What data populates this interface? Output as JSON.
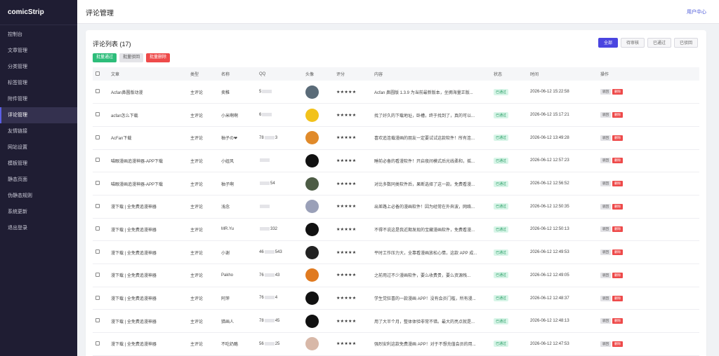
{
  "app": {
    "brand": "comicStrip"
  },
  "sidebar": {
    "items": [
      {
        "label": "控制台"
      },
      {
        "label": "文章管理"
      },
      {
        "label": "分类管理"
      },
      {
        "label": "标签管理"
      },
      {
        "label": "附件管理"
      },
      {
        "label": "评论管理",
        "active": true
      },
      {
        "label": "友情链接"
      },
      {
        "label": "网站设置"
      },
      {
        "label": "模板管理"
      },
      {
        "label": "静态页面"
      },
      {
        "label": "伪静态规则"
      },
      {
        "label": "系统更新"
      },
      {
        "label": "退出登录"
      }
    ]
  },
  "header": {
    "title": "评论管理",
    "user_center": "用户中心"
  },
  "card": {
    "title": "评论列表 (17)",
    "filters": [
      "全部",
      "待审核",
      "已通过",
      "已驳回"
    ],
    "bulk": {
      "approve": "批量通过",
      "reject": "批量驳回",
      "delete": "批量删除"
    }
  },
  "table": {
    "headers": [
      "文章",
      "类型",
      "名称",
      "QQ",
      "头像",
      "评分",
      "内容",
      "状态",
      "时间",
      "操作"
    ],
    "op_reject": "驳回",
    "op_delete": "删除",
    "rows": [
      {
        "article": "Acfan鼻圆版动漫",
        "type": "主评论",
        "name": "卖稚",
        "qq_pre": "5",
        "qq_post": "",
        "rating": "★★★★★",
        "content": "Acfan 鼻圆版 1.3.9 为当前最新版本，坐拥海量正版...",
        "status": "已通过",
        "time": "2026-06-12 15:22:58",
        "avatar": "#5a6b78"
      },
      {
        "article": "acfan怎么下载",
        "type": "主评论",
        "name": "小米啊啊",
        "qq_pre": "6",
        "qq_post": "",
        "rating": "★★★★★",
        "content": "找了好久的下载地址，卧槽，终于找到了，真的可以...",
        "status": "已通过",
        "time": "2026-06-12 15:17:21",
        "avatar": "#f2c21b"
      },
      {
        "article": "AcFan下载",
        "type": "主评论",
        "name": "柚子の❤",
        "qq_pre": "78",
        "qq_post": "3",
        "rating": "★★★★★",
        "content": "喜欢追连载漫画的朋友一定要试试这款软件！所有连...",
        "status": "已通过",
        "time": "2026-06-12 13:49:28",
        "avatar": "#e08a2a"
      },
      {
        "article": "喵眼漫画追漫神器-APP下载",
        "type": "主评论",
        "name": "小妞风",
        "qq_pre": "",
        "qq_post": "",
        "rating": "★★★★★",
        "content": "睡前必备的看漫软件！开启夜间模式后光线柔和，摇...",
        "status": "已通过",
        "time": "2026-06-12 12:57:23",
        "avatar": "#111111"
      },
      {
        "article": "喵眼漫画追漫神器-APP下载",
        "type": "主评论",
        "name": "柚子啊",
        "qq_pre": "",
        "qq_post": "54",
        "rating": "★★★★★",
        "content": "对比多数同类软件后，果断选择了这一款。免费看漫...",
        "status": "已通过",
        "time": "2026-06-12 12:56:52",
        "avatar": "#4d5c45"
      },
      {
        "article": "漫下载 | 全免费追漫神器",
        "type": "主评论",
        "name": "浅念",
        "qq_pre": "",
        "qq_post": "",
        "rating": "★★★★★",
        "content": "出差路上必备的漫画软件！因为经常在外奔波，网络...",
        "status": "已通过",
        "time": "2026-06-12 12:50:35",
        "avatar": "#9aa0b8"
      },
      {
        "article": "漫下载 | 全免费追漫神器",
        "type": "主评论",
        "name": "MR.Yu",
        "qq_pre": "",
        "qq_post": "332",
        "rating": "★★★★★",
        "content": "不得不说这是我近期发现的宝藏漫画软件，免费看漫...",
        "status": "已通过",
        "time": "2026-06-12 12:50:13",
        "avatar": "#111111"
      },
      {
        "article": "漫下载 | 全免费追漫神器",
        "type": "主评论",
        "name": "小谢",
        "qq_pre": "46",
        "qq_post": "543",
        "rating": "★★★★★",
        "content": "平时工作压力大，全靠看漫画放松心情，这款 APP 成...",
        "status": "已通过",
        "time": "2026-06-12 12:49:53",
        "avatar": "#222222"
      },
      {
        "article": "漫下载 | 全免费追漫神器",
        "type": "主评论",
        "name": "Pakho",
        "qq_pre": "76",
        "qq_post": "43",
        "rating": "★★★★★",
        "content": "之前用过不少漫画软件，要么收费贵，要么资源残...",
        "status": "已通过",
        "time": "2026-06-12 12:49:05",
        "avatar": "#e07a20"
      },
      {
        "article": "漫下载 | 全免费追漫神器",
        "type": "主评论",
        "name": "阿萍",
        "qq_pre": "76",
        "qq_post": "4",
        "rating": "★★★★★",
        "content": "学生党狂喜的一款漫画 APP！没有会员门槛，所有漫...",
        "status": "已通过",
        "time": "2026-06-12 12:48:37",
        "avatar": "#111111"
      },
      {
        "article": "漫下载 | 全免费追漫神器",
        "type": "主评论",
        "name": "猎画人",
        "qq_pre": "78",
        "qq_post": "45",
        "rating": "★★★★★",
        "content": "用了大半个月，整体体验非常不错。最大的亮点就是...",
        "status": "已通过",
        "time": "2026-06-12 12:48:13",
        "avatar": "#111111"
      },
      {
        "article": "漫下载 | 全免费追漫神器",
        "type": "主评论",
        "name": "不吃奶酪",
        "qq_pre": "56",
        "qq_post": "25",
        "rating": "★★★★★",
        "content": "强烈安利这款免费漫画 APP！对于不想充值会员的用...",
        "status": "已通过",
        "time": "2026-06-12 12:47:53",
        "avatar": "#d8b8a8"
      }
    ]
  }
}
